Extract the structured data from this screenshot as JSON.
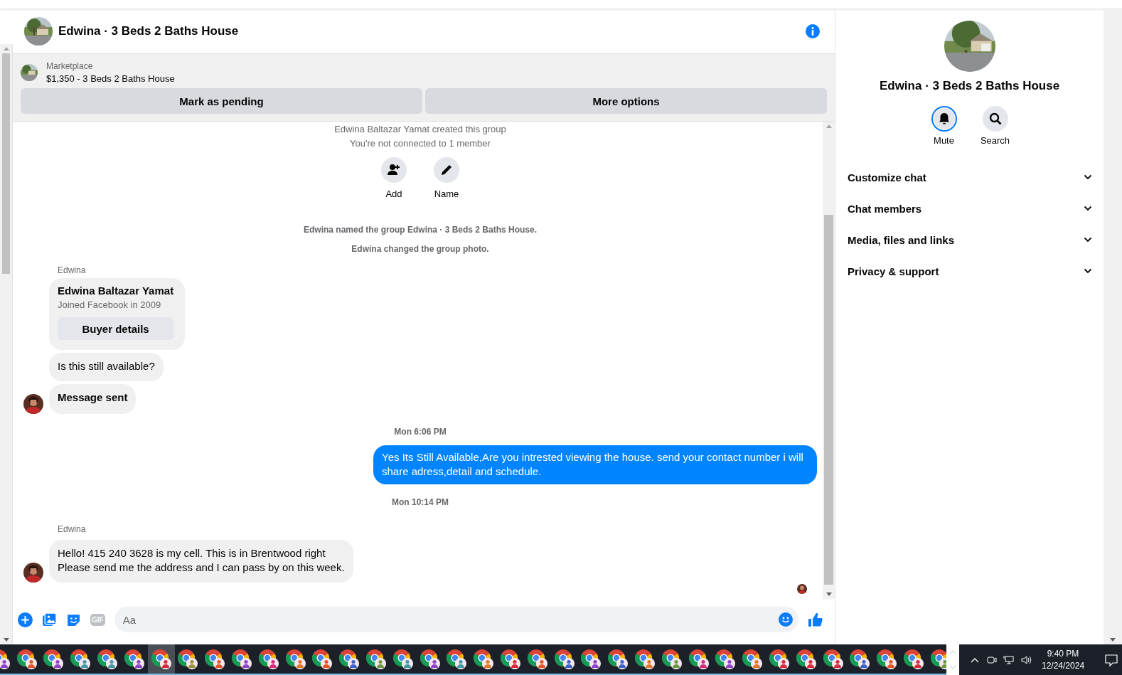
{
  "chat_header": {
    "title": "Edwina · 3 Beds 2 Baths House"
  },
  "listing": {
    "source": "Marketplace",
    "title": "$1,350 - 3 Beds 2 Baths House",
    "buttons": [
      "Mark as pending",
      "More options"
    ]
  },
  "messages": [
    {
      "kind": "system",
      "text": "Edwina Baltazar Yamat created this group"
    },
    {
      "kind": "system",
      "text": "You're not connected to 1 member"
    },
    {
      "kind": "actions",
      "items": [
        {
          "label": "Add"
        },
        {
          "label": "Name"
        }
      ]
    },
    {
      "kind": "event",
      "text": "Edwina named the group Edwina · 3 Beds 2 Baths House."
    },
    {
      "kind": "event",
      "text": "Edwina changed the group photo."
    },
    {
      "kind": "sender",
      "text": "Edwina"
    },
    {
      "kind": "profile_card",
      "name": "Edwina Baltazar Yamat",
      "detail": "Joined Facebook in 2009",
      "button": "Buyer details"
    },
    {
      "kind": "incoming",
      "text": "Is this still available?",
      "bold": false,
      "avatar": false
    },
    {
      "kind": "incoming",
      "text": "Message sent",
      "bold": true,
      "avatar": true
    },
    {
      "kind": "timestamp",
      "text": "Mon 6:06 PM"
    },
    {
      "kind": "outgoing",
      "text": "Yes Its Still Available,Are you intrested viewing the house. send your contact number i will share adress,detail and schedule."
    },
    {
      "kind": "timestamp",
      "text": "Mon 10:14 PM"
    },
    {
      "kind": "sender",
      "text": "Edwina"
    },
    {
      "kind": "incoming",
      "text": "Hello! 415 240 3628 is my cell. This is in Brentwood right\nPlease send me the address and I can pass by on this week.",
      "bold": false,
      "avatar": true
    },
    {
      "kind": "read_receipt"
    }
  ],
  "composer": {
    "placeholder": "Aa",
    "gif_label": "GIF"
  },
  "details_panel": {
    "title": "Edwina · 3 Beds 2 Baths House",
    "actions": [
      {
        "label": "Mute",
        "selected": true
      },
      {
        "label": "Search",
        "selected": false
      }
    ],
    "sections": [
      {
        "label": "Customize chat",
        "expanded": false
      },
      {
        "label": "Chat members",
        "expanded": false
      },
      {
        "label": "Media, files and links",
        "expanded": false
      },
      {
        "label": "Privacy & support",
        "expanded": false
      }
    ]
  },
  "taskbar": {
    "apps": [
      {
        "color": "#8e44c8",
        "selected": false
      },
      {
        "color": "#e0552a",
        "selected": false
      },
      {
        "color": "#8e44c8",
        "selected": false
      },
      {
        "color": "#3f9aa3",
        "selected": false
      },
      {
        "color": "#3f9aa3",
        "selected": false
      },
      {
        "color": "#8e44c8",
        "selected": false
      },
      {
        "color": "#d8283c",
        "selected": true
      },
      {
        "color": "#9a9040",
        "selected": false
      },
      {
        "color": "#e0552a",
        "selected": false
      },
      {
        "color": "#8e44c8",
        "selected": false
      },
      {
        "color": "#d8287c",
        "selected": false
      },
      {
        "color": "#e07a2a",
        "selected": false
      },
      {
        "color": "#e0552a",
        "selected": false
      },
      {
        "color": "#3a62c8",
        "selected": false
      },
      {
        "color": "#6a9a40",
        "selected": false
      },
      {
        "color": "#3f9aa3",
        "selected": false
      },
      {
        "color": "#8e44c8",
        "selected": false
      },
      {
        "color": "#3f9aa3",
        "selected": false
      },
      {
        "color": "#e07a2a",
        "selected": false
      },
      {
        "color": "#d8283c",
        "selected": false
      },
      {
        "color": "#e0552a",
        "selected": false
      },
      {
        "color": "#3a62c8",
        "selected": false
      },
      {
        "color": "#8e44c8",
        "selected": false
      },
      {
        "color": "#3a62c8",
        "selected": false
      },
      {
        "color": "#e07a2a",
        "selected": false
      },
      {
        "color": "#6a9a40",
        "selected": false
      },
      {
        "color": "#d8287c",
        "selected": false
      },
      {
        "color": "#8e44c8",
        "selected": false
      },
      {
        "color": "#e07a2a",
        "selected": false
      },
      {
        "color": "#d8283c",
        "selected": false
      },
      {
        "color": "#d8283c",
        "selected": false
      },
      {
        "color": "#d8283c",
        "selected": false
      },
      {
        "color": "#3a62c8",
        "selected": false
      },
      {
        "color": "#e0552a",
        "selected": false
      },
      {
        "color": "#d8283c",
        "selected": false
      },
      {
        "color": "#6a9a40",
        "selected": false
      }
    ],
    "time": "9:40 PM",
    "date": "12/24/2024"
  }
}
